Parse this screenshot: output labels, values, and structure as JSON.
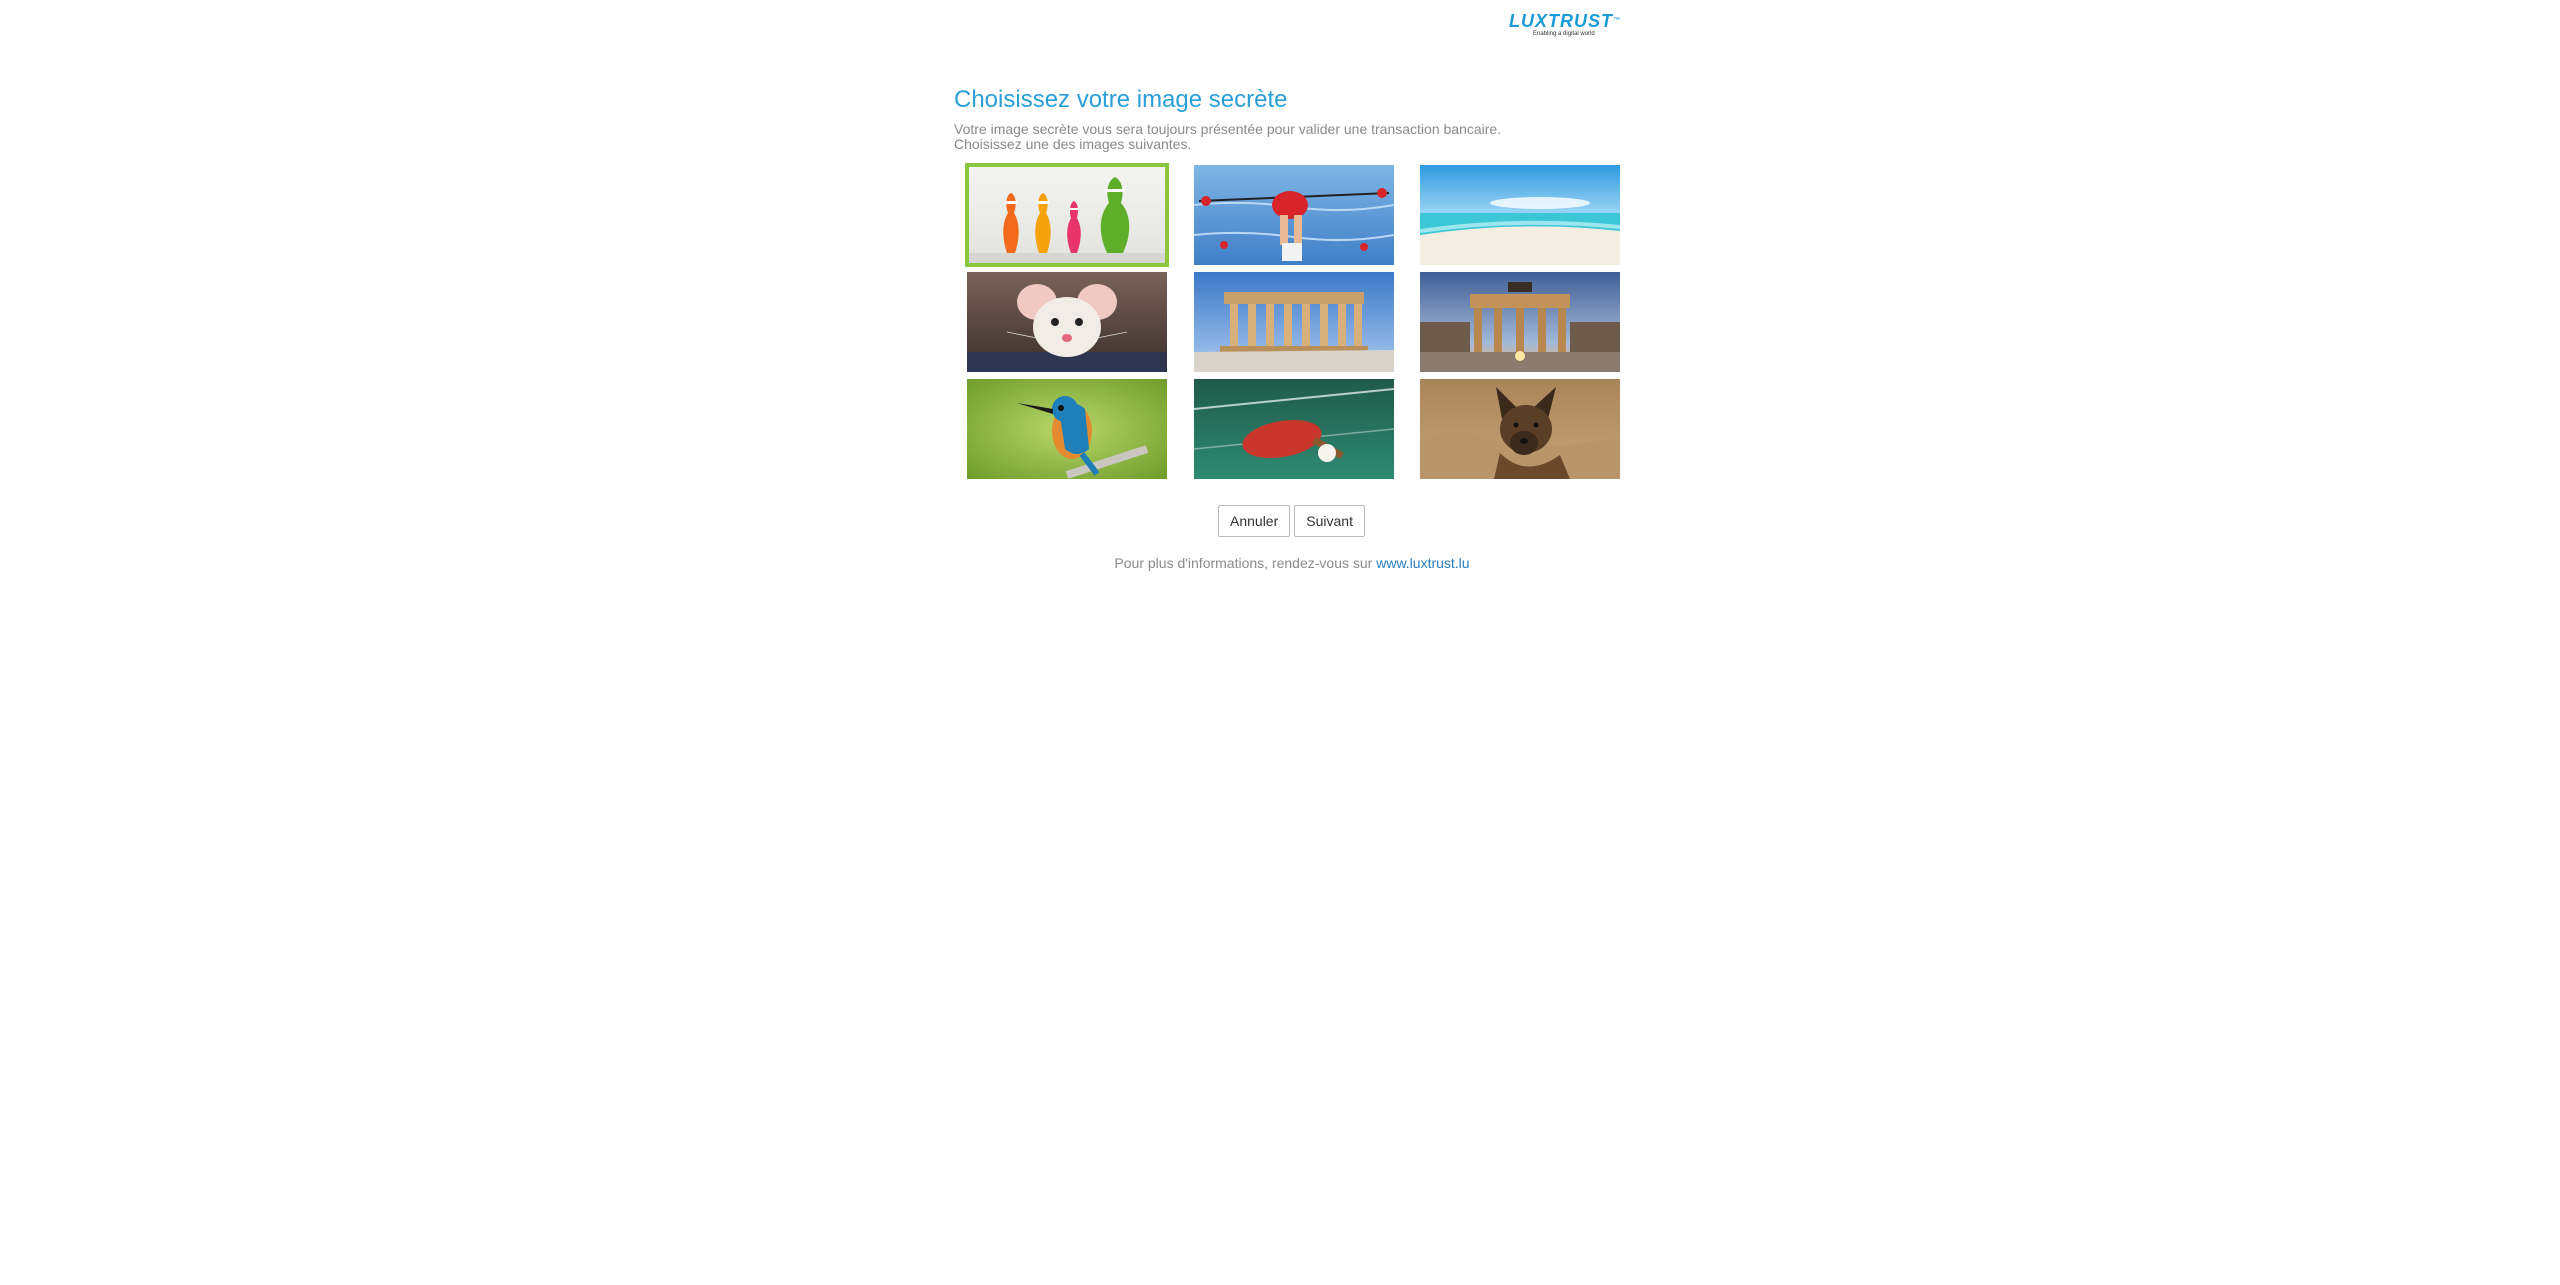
{
  "header": {
    "logo_text": "LUXTRUST",
    "logo_tm": "™",
    "logo_tagline": "Enabling a digital world"
  },
  "main": {
    "title": "Choisissez votre image secrète",
    "description_line1": "Votre image secrète vous sera toujours présentée pour valider une transaction bancaire.",
    "description_line2": "Choisissez une des images suivantes."
  },
  "images": [
    {
      "subject": "bowling-pins",
      "selected": true
    },
    {
      "subject": "rowing",
      "selected": false
    },
    {
      "subject": "beach",
      "selected": false
    },
    {
      "subject": "mouse",
      "selected": false
    },
    {
      "subject": "parthenon",
      "selected": false
    },
    {
      "subject": "brandenburg-gate",
      "selected": false
    },
    {
      "subject": "kingfisher",
      "selected": false
    },
    {
      "subject": "table-tennis",
      "selected": false
    },
    {
      "subject": "german-shepherd",
      "selected": false
    }
  ],
  "buttons": {
    "cancel_label": "Annuler",
    "next_label": "Suivant"
  },
  "footer": {
    "text": "Pour plus d'informations, rendez-vous sur",
    "link_text": "www.luxtrust.lu"
  },
  "colors": {
    "accent": "#2a9fd6",
    "selected_border": "#8cc63f",
    "link": "#2a7fbf",
    "muted_text": "#8a8a8a"
  }
}
